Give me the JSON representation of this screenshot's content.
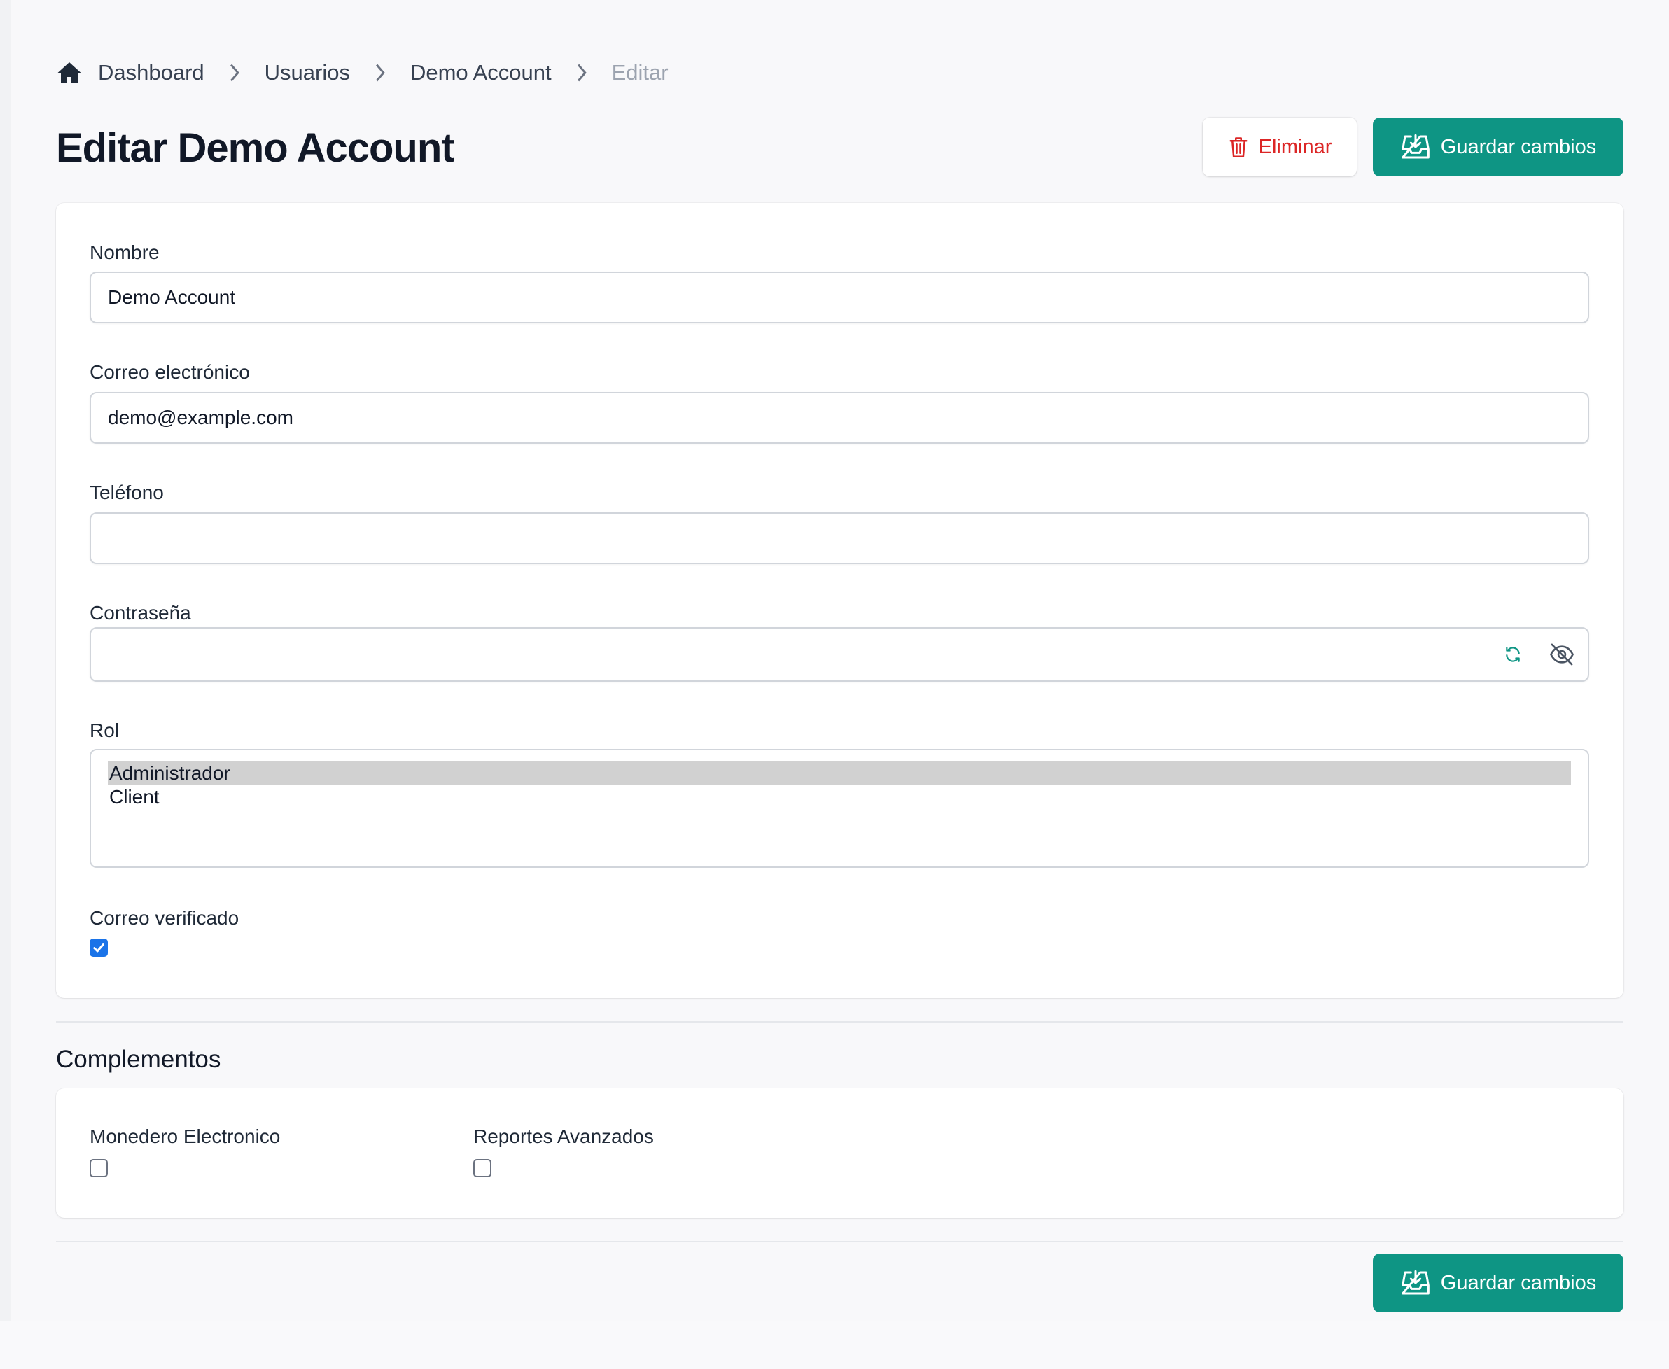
{
  "breadcrumb": {
    "items": [
      "Dashboard",
      "Usuarios",
      "Demo Account",
      "Editar"
    ]
  },
  "header": {
    "title": "Editar Demo Account",
    "delete_label": "Eliminar",
    "save_label": "Guardar cambios"
  },
  "form": {
    "name": {
      "label": "Nombre",
      "value": "Demo Account"
    },
    "email": {
      "label": "Correo electrónico",
      "value": "demo@example.com"
    },
    "phone": {
      "label": "Teléfono",
      "value": ""
    },
    "password": {
      "label": "Contraseña",
      "value": ""
    },
    "role": {
      "label": "Rol",
      "options": [
        "Administrador",
        "Client"
      ],
      "selected": "Administrador"
    },
    "email_verified": {
      "label": "Correo verificado",
      "checked": true
    }
  },
  "addons": {
    "title": "Complementos",
    "items": [
      {
        "label": "Monedero Electronico",
        "checked": false
      },
      {
        "label": "Reportes Avanzados",
        "checked": false
      }
    ]
  },
  "footer": {
    "save_label": "Guardar cambios"
  },
  "colors": {
    "primary": "#0e9584",
    "danger": "#dc2626",
    "checkbox": "#1a73e8"
  },
  "icons": [
    "home-icon",
    "chevron-right-icon",
    "trash-icon",
    "inbox-download-icon",
    "refresh-icon",
    "eye-off-icon",
    "check-icon"
  ]
}
